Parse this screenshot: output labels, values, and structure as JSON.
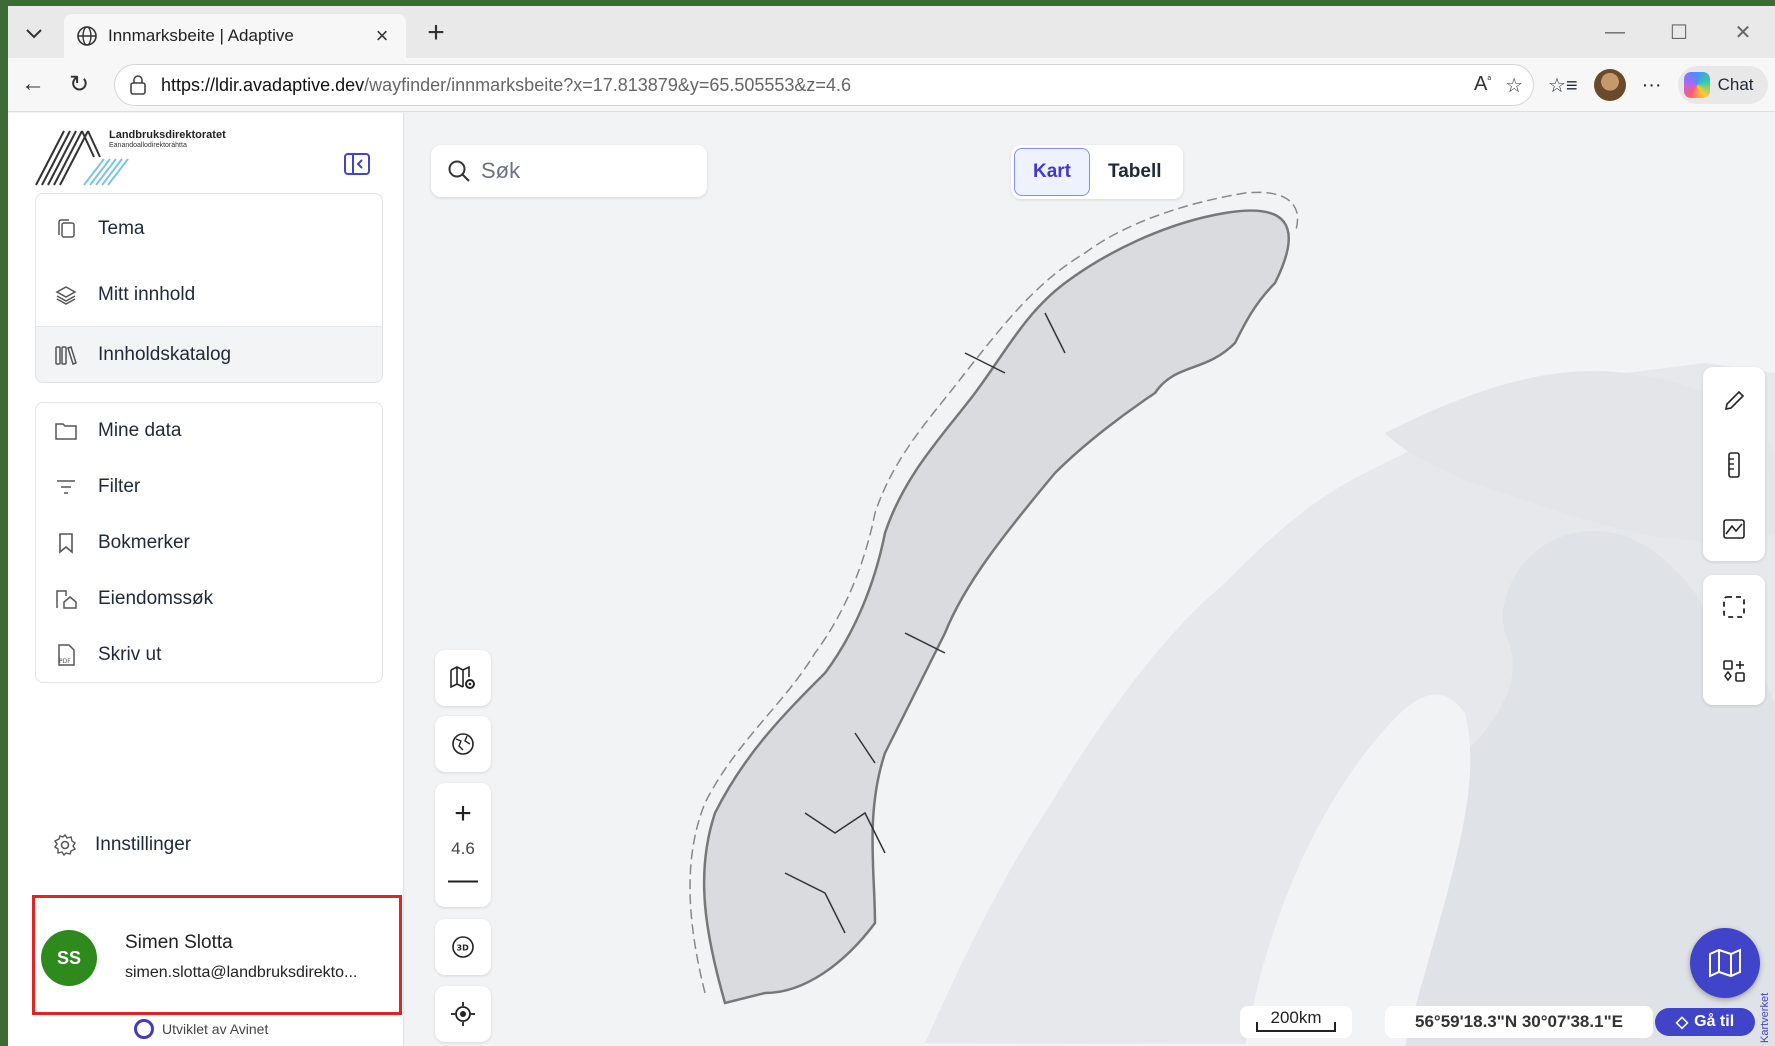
{
  "browser": {
    "tab_title": "Innmarksbeite | Adaptive",
    "url_host": "https://ldir.avadaptive.dev",
    "url_path": "/wayfinder/innmarksbeite?x=17.813879&y=65.505553&z=4.6",
    "copilot_label": "Chat"
  },
  "sidebar": {
    "logo_title": "Landbruksdirektoratet",
    "logo_subtitle": "Eanandoallodirektoráhtta",
    "group1": [
      {
        "label": "Tema",
        "icon": "tema-icon"
      },
      {
        "label": "Mitt innhold",
        "icon": "layers-icon"
      },
      {
        "label": "Innholdskatalog",
        "icon": "library-icon"
      }
    ],
    "group2": [
      {
        "label": "Mine data",
        "icon": "folder-icon"
      },
      {
        "label": "Filter",
        "icon": "filter-icon"
      },
      {
        "label": "Bokmerker",
        "icon": "bookmark-icon"
      },
      {
        "label": "Eiendomssøk",
        "icon": "property-search-icon"
      },
      {
        "label": "Skriv ut",
        "icon": "pdf-icon"
      }
    ],
    "settings_label": "Innstillinger",
    "user": {
      "initials": "SS",
      "name": "Simen Slotta",
      "email": "simen.slotta@landbruksdirekto..."
    },
    "developed_by": "Utviklet av Avinet"
  },
  "map": {
    "search_placeholder": "Søk",
    "view_toggle": {
      "map": "Kart",
      "table": "Tabell",
      "active": "Kart"
    },
    "zoom_level": "4.6",
    "scale_label": "200km",
    "coordinates": "56°59'18.3\"N 30°07'38.1\"E",
    "goto_label": "Gå til",
    "attribution": "Kartverket"
  },
  "colors": {
    "accent": "#3f44c8",
    "highlight_box": "#e02424",
    "avatar": "#2f8a1e"
  }
}
